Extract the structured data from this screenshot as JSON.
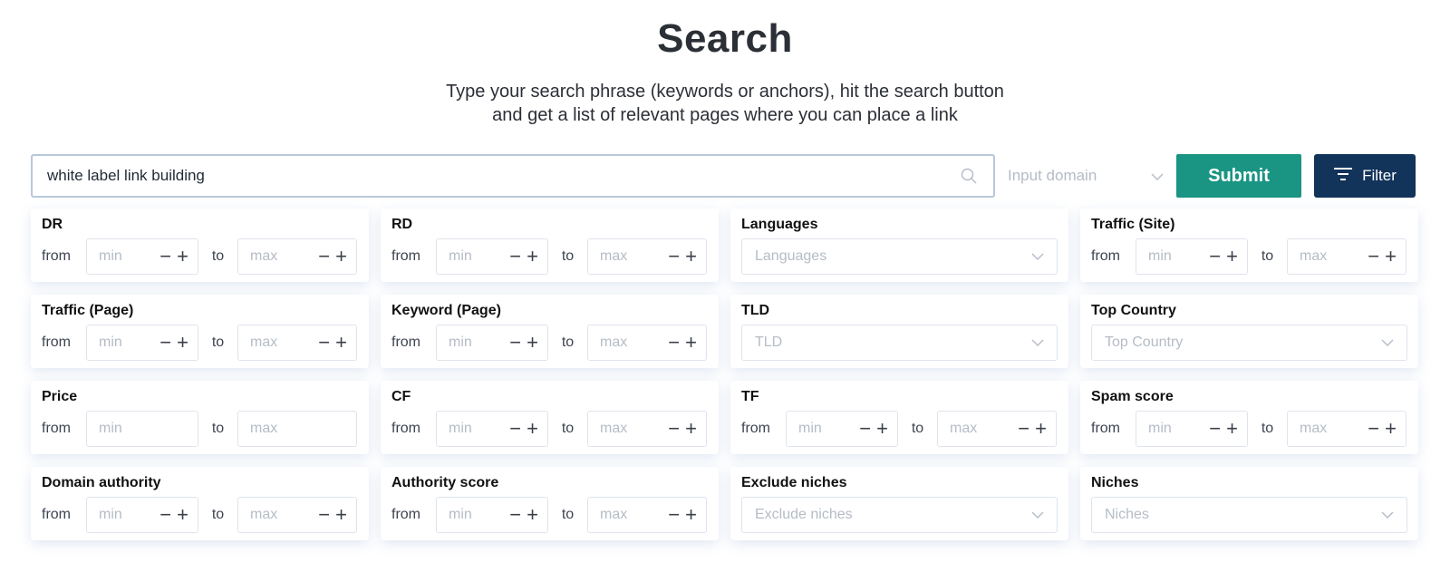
{
  "header": {
    "title": "Search",
    "subtitle_line1": "Type your search phrase (keywords or anchors), hit the search button",
    "subtitle_line2": "and get a list of relevant pages where you can place a link"
  },
  "search": {
    "value": "white label link building",
    "domain_placeholder": "Input domain",
    "submit_label": "Submit",
    "filter_label": "Filter"
  },
  "common": {
    "from": "from",
    "to": "to",
    "min": "min",
    "max": "max"
  },
  "filters": {
    "dr": "DR",
    "rd": "RD",
    "languages": {
      "label": "Languages",
      "placeholder": "Languages"
    },
    "traffic_site": "Traffic (Site)",
    "traffic_page": "Traffic (Page)",
    "keyword_page": "Keyword (Page)",
    "tld": {
      "label": "TLD",
      "placeholder": "TLD"
    },
    "top_country": {
      "label": "Top Country",
      "placeholder": "Top Country"
    },
    "price": "Price",
    "cf": "CF",
    "tf": "TF",
    "spam_score": "Spam score",
    "domain_authority": "Domain authority",
    "authority_score": "Authority score",
    "exclude_niches": {
      "label": "Exclude niches",
      "placeholder": "Exclude niches"
    },
    "niches": {
      "label": "Niches",
      "placeholder": "Niches"
    }
  },
  "colors": {
    "submit": "#1a9483",
    "filter": "#12335a"
  },
  "icons": [
    "search-icon",
    "chevron-down-icon",
    "filter-icon",
    "minus-icon",
    "plus-icon"
  ]
}
